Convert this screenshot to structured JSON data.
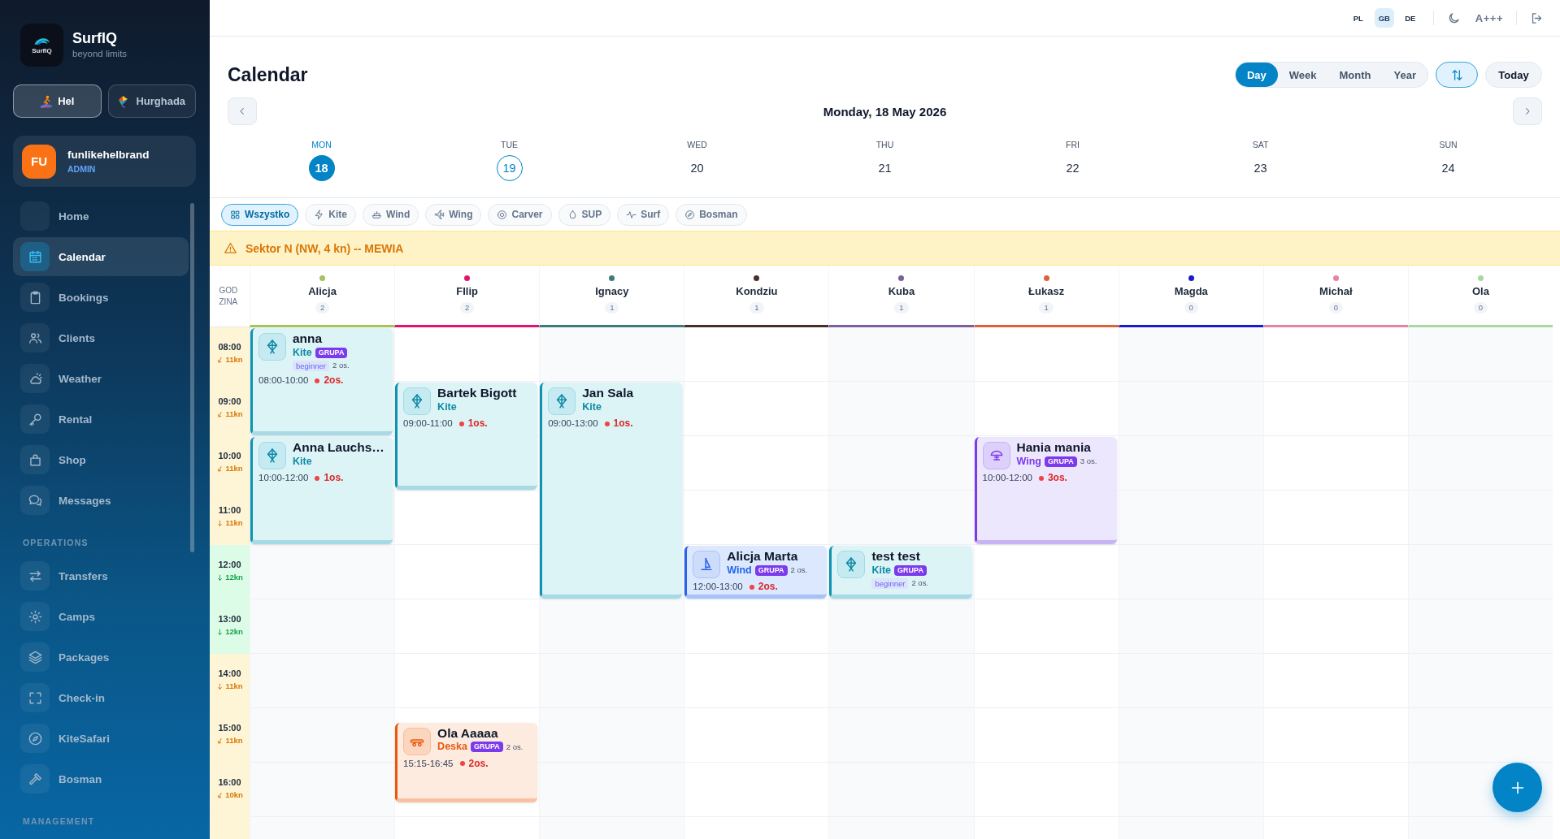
{
  "sidebar": {
    "logo_text": "SurfIQ",
    "brand": "SurfIQ",
    "tagline": "beyond limits",
    "locations": [
      {
        "label": "Hel",
        "selected": true
      },
      {
        "label": "Hurghada",
        "selected": false
      }
    ],
    "user": {
      "initials": "FU",
      "name": "funlikehelbrand",
      "role": "ADMIN"
    },
    "nav_sections": [
      {
        "items": [
          {
            "label": "Home",
            "selected": false
          },
          {
            "label": "Calendar",
            "selected": true
          },
          {
            "label": "Bookings",
            "selected": false
          },
          {
            "label": "Clients",
            "selected": false
          },
          {
            "label": "Weather",
            "selected": false
          },
          {
            "label": "Rental",
            "selected": false
          },
          {
            "label": "Shop",
            "selected": false
          },
          {
            "label": "Messages",
            "selected": false
          }
        ]
      },
      {
        "heading": "OPERATIONS",
        "items": [
          {
            "label": "Transfers",
            "selected": false
          },
          {
            "label": "Camps",
            "selected": false
          },
          {
            "label": "Packages",
            "selected": false
          },
          {
            "label": "Check-in",
            "selected": false
          },
          {
            "label": "KiteSafari",
            "selected": false
          },
          {
            "label": "Bosman",
            "selected": false
          }
        ]
      },
      {
        "heading": "MANAGEMENT"
      }
    ]
  },
  "topbar": {
    "languages": [
      {
        "label": "PL",
        "selected": false
      },
      {
        "label": "GB",
        "selected": true
      },
      {
        "label": "DE",
        "selected": false
      }
    ],
    "font_size_label": "A+++"
  },
  "header": {
    "title": "Calendar",
    "views": [
      {
        "label": "Day",
        "selected": true
      },
      {
        "label": "Week",
        "selected": false
      },
      {
        "label": "Month",
        "selected": false
      },
      {
        "label": "Year",
        "selected": false
      }
    ],
    "today_label": "Today",
    "date": "Monday, 18 May 2026",
    "days": [
      {
        "name": "MON",
        "number": "18",
        "selected": true,
        "today": false
      },
      {
        "name": "TUE",
        "number": "19",
        "selected": false,
        "today": true
      },
      {
        "name": "WED",
        "number": "20",
        "selected": false,
        "today": false
      },
      {
        "name": "THU",
        "number": "21",
        "selected": false,
        "today": false
      },
      {
        "name": "FRI",
        "number": "22",
        "selected": false,
        "today": false
      },
      {
        "name": "SAT",
        "number": "23",
        "selected": false,
        "today": false
      },
      {
        "name": "SUN",
        "number": "24",
        "selected": false,
        "today": false
      }
    ]
  },
  "filters": [
    {
      "label": "Wszystko",
      "selected": true
    },
    {
      "label": "Kite",
      "selected": false
    },
    {
      "label": "Wind",
      "selected": false
    },
    {
      "label": "Wing",
      "selected": false
    },
    {
      "label": "Carver",
      "selected": false
    },
    {
      "label": "SUP",
      "selected": false
    },
    {
      "label": "Surf",
      "selected": false
    },
    {
      "label": "Bosman",
      "selected": false
    }
  ],
  "alert": {
    "text": "Sektor N (NW, 4 kn) -- MEWIA"
  },
  "schedule": {
    "time_heading": "GODZINA",
    "hours": [
      {
        "time": "08:00",
        "wind": "11kn",
        "highlighted": false,
        "tilted": true
      },
      {
        "time": "09:00",
        "wind": "11kn",
        "highlighted": false,
        "tilted": true
      },
      {
        "time": "10:00",
        "wind": "11kn",
        "highlighted": false,
        "tilted": true
      },
      {
        "time": "11:00",
        "wind": "11kn",
        "highlighted": false,
        "tilted": false
      },
      {
        "time": "12:00",
        "wind": "12kn",
        "highlighted": true,
        "tilted": false
      },
      {
        "time": "13:00",
        "wind": "12kn",
        "highlighted": true,
        "tilted": false
      },
      {
        "time": "14:00",
        "wind": "11kn",
        "highlighted": false,
        "tilted": false
      },
      {
        "time": "15:00",
        "wind": "11kn",
        "highlighted": false,
        "tilted": true
      },
      {
        "time": "16:00",
        "wind": "10kn",
        "highlighted": false,
        "tilted": true
      }
    ],
    "instructors": [
      {
        "name": "Alicja",
        "count": "2",
        "color": "#a3c45a",
        "slots": [
          {
            "kind": "kite",
            "name": "anna",
            "sport": "Kite",
            "badge": "GRUPA",
            "level_tag": "beginner",
            "people": "2 os.",
            "time": "08:00-10:00",
            "count": "2os."
          },
          {
            "kind": "kite",
            "name": "Anna Lauchs…",
            "sport": "Kite",
            "time": "10:00-12:00",
            "count": "1os."
          }
        ]
      },
      {
        "name": "FIlip",
        "count": "2",
        "color": "#e0156e",
        "slots": [
          {
            "kind": "free"
          },
          {
            "kind": "kite",
            "name": "Bartek Bigott",
            "sport": "Kite",
            "time": "09:00-11:00",
            "count": "1os."
          },
          {
            "kind": "free"
          },
          {
            "kind": "free"
          },
          {
            "kind": "free"
          },
          {
            "kind": "free"
          },
          {
            "kind": "deska",
            "name": "Ola Aaaaa",
            "sport": "Deska",
            "badge": "GRUPA",
            "people": "2 os.",
            "time": "15:15-16:45",
            "count": "2os."
          }
        ]
      },
      {
        "name": "Ignacy",
        "count": "1",
        "color": "#3d7a78",
        "slots": [
          {
            "kind": "free"
          },
          {
            "kind": "kite",
            "name": "Jan Sala",
            "sport": "Kite",
            "time": "09:00-13:00",
            "count": "1os."
          }
        ]
      },
      {
        "name": "Kondziu",
        "count": "1",
        "color": "#4a2e2a",
        "slots": [
          {
            "kind": "free"
          },
          {
            "kind": "free"
          },
          {
            "kind": "free"
          },
          {
            "kind": "free"
          },
          {
            "kind": "wind",
            "name": "Alicja Marta",
            "sport": "Wind",
            "badge": "GRUPA",
            "people": "2 os.",
            "time": "12:00-13:00",
            "count": "2os."
          }
        ]
      },
      {
        "name": "Kuba",
        "count": "1",
        "color": "#7b5ea0",
        "slots": [
          {
            "kind": "free"
          },
          {
            "kind": "free"
          },
          {
            "kind": "free"
          },
          {
            "kind": "free"
          },
          {
            "kind": "kite",
            "name": "test test",
            "sport": "Kite",
            "badge": "GRUPA",
            "level_tag": "beginner",
            "people": "2 os."
          }
        ]
      },
      {
        "name": "Łukasz",
        "count": "1",
        "color": "#e0603a",
        "slots": [
          {
            "kind": "free"
          },
          {
            "kind": "free"
          },
          {
            "kind": "wing",
            "name": "Hania mania",
            "sport": "Wing",
            "badge": "GRUPA",
            "people": "3 os.",
            "time": "10:00-12:00",
            "count": "3os."
          }
        ]
      },
      {
        "name": "Magda",
        "count": "0",
        "color": "#1a1acc"
      },
      {
        "name": "Michał",
        "count": "0",
        "color": "#e683a0"
      },
      {
        "name": "Ola",
        "count": "0",
        "color": "#a8d8a0"
      }
    ]
  }
}
